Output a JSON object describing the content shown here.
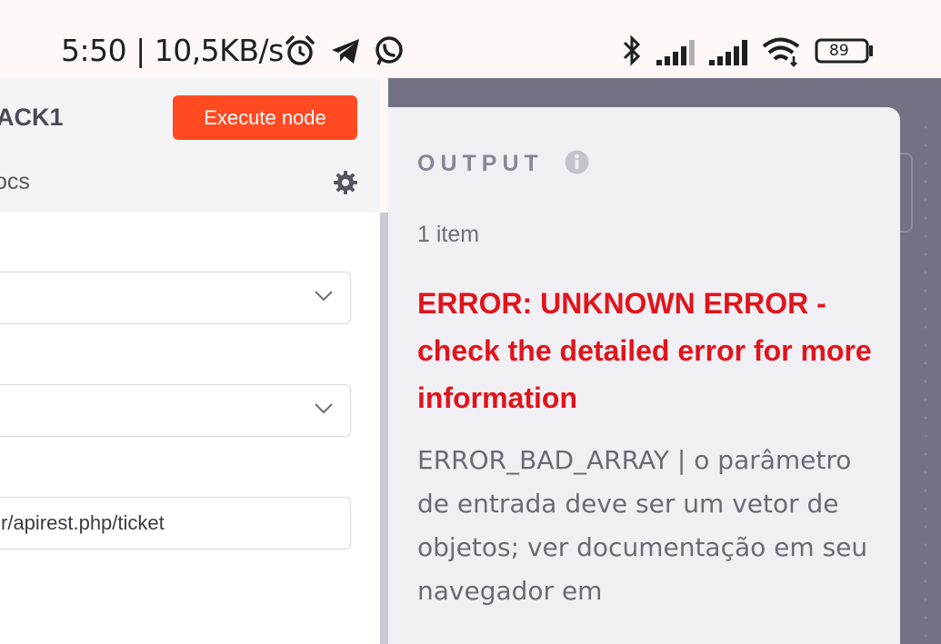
{
  "status_bar": {
    "time_speed": "5:50 | 10,5KB/s",
    "battery": "89",
    "icons": [
      "alarm-icon",
      "telegram-icon",
      "whatsapp-icon",
      "bluetooth-icon",
      "signal-icon",
      "signal-icon",
      "wifi-icon",
      "battery-icon"
    ]
  },
  "node_panel": {
    "node_name": "ACK1",
    "execute_label": "Execute node",
    "docs_label": "ocs",
    "url_value": "r/apirest.php/ticket"
  },
  "output": {
    "title": "OUTPUT",
    "item_count": "1 item",
    "error_title": "ERROR: UNKNOWN ERROR - check the detailed error for more information",
    "error_detail": "ERROR_BAD_ARRAY | o parâmetro de entrada deve ser um vetor de objetos; ver documentação em seu navegador em"
  },
  "colors": {
    "accent": "#ff4a22",
    "error": "#e0141c",
    "overlay": "#727284"
  }
}
